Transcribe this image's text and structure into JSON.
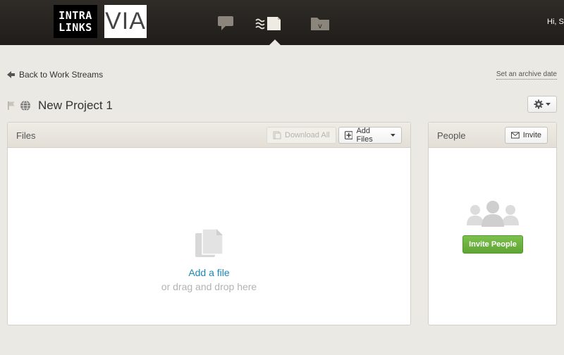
{
  "header": {
    "logo_line1": "INTRA",
    "logo_line2": "LINKS",
    "logo_via": "VIA",
    "greeting": "Hi, S",
    "nav": [
      {
        "name": "messages",
        "icon": "chat-bubble-icon"
      },
      {
        "name": "work-streams",
        "icon": "work-streams-icon",
        "active": true
      },
      {
        "name": "vault",
        "icon": "folder-v-icon"
      }
    ]
  },
  "subheader": {
    "back_label": "Back to Work Streams",
    "archive_label": "Set an archive date"
  },
  "project": {
    "title": "New Project 1"
  },
  "files": {
    "title": "Files",
    "download_all_label": "Download All",
    "add_files_label": "Add Files",
    "add_file_link": "Add a file",
    "drag_hint": "or drag and drop here"
  },
  "people": {
    "title": "People",
    "invite_label": "Invite",
    "invite_people_label": "Invite People"
  },
  "colors": {
    "topbar": "#2a2623",
    "background": "#ebe9e3",
    "link_blue": "#1c87b8",
    "green_button": "#6cb33f"
  }
}
